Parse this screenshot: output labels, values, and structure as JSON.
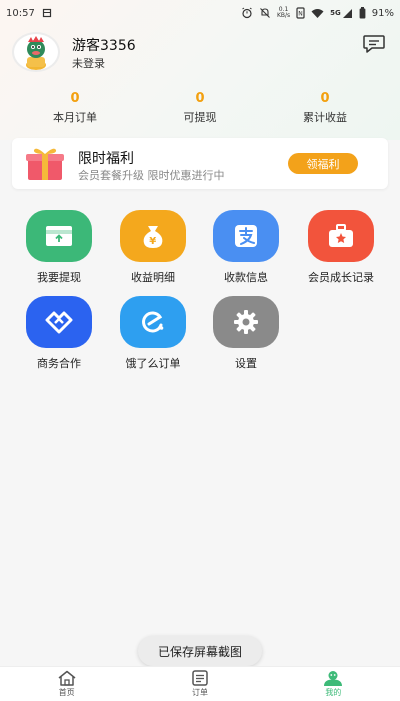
{
  "status_bar": {
    "time": "10:57",
    "net_speed_top": "0.1",
    "net_speed_bottom": "KB/s",
    "network": "5G",
    "battery": "91%"
  },
  "profile": {
    "username": "游客3356",
    "login_status": "未登录"
  },
  "stats": [
    {
      "value": "0",
      "label": "本月订单"
    },
    {
      "value": "0",
      "label": "可提现"
    },
    {
      "value": "0",
      "label": "累计收益"
    }
  ],
  "welfare": {
    "title": "限时福利",
    "subtitle": "会员套餐升级 限时优惠进行中",
    "button": "领福利"
  },
  "menu": [
    {
      "label": "我要提现",
      "icon": "card-icon",
      "color": "#3cb878"
    },
    {
      "label": "收益明细",
      "icon": "money-bag-icon",
      "color": "#f4a81d"
    },
    {
      "label": "收款信息",
      "icon": "alipay-icon",
      "color": "#4a8ff2"
    },
    {
      "label": "会员成长记录",
      "icon": "medical-kit-icon",
      "color": "#f2543c"
    },
    {
      "label": "商务合作",
      "icon": "handshake-icon",
      "color": "#2b63f0"
    },
    {
      "label": "饿了么订单",
      "icon": "eleme-icon",
      "color": "#2e9ff0"
    },
    {
      "label": "设置",
      "icon": "gear-icon",
      "color": "#8a8a8a"
    }
  ],
  "toast": "已保存屏幕截图",
  "nav": [
    {
      "label": "首页",
      "icon": "home-icon"
    },
    {
      "label": "订单",
      "icon": "orders-icon"
    },
    {
      "label": "我的",
      "icon": "user-icon"
    }
  ],
  "colors": {
    "accent": "#3dba78",
    "stat_value": "#f3a00f",
    "welfare_button": "#f3a21a"
  }
}
